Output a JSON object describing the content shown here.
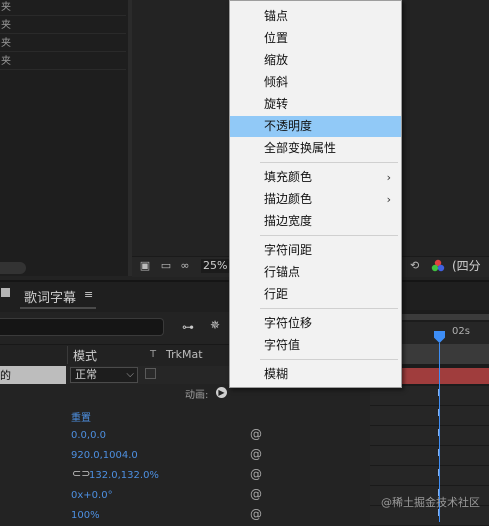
{
  "project_panel": {
    "rows": [
      "夹",
      "夹",
      "夹",
      "夹"
    ]
  },
  "viewer_bar": {
    "zoom": "25%",
    "quality": "(四分"
  },
  "timeline": {
    "tab_label": "歌词字幕",
    "tab_menu_icon": "≡",
    "columns": {
      "mode": "模式",
      "t": "T",
      "trkmat": "TrkMat"
    },
    "layer": {
      "name": "的",
      "mode": "正常"
    },
    "animate_label": "动画:",
    "properties": {
      "reset": "重置",
      "anchor": "0.0,0.0",
      "position": "920.0,1004.0",
      "scale": "132.0,132.0%",
      "rotation": "0x+0.0°",
      "opacity": "100%"
    },
    "ruler_label": "02s",
    "watermark": "@稀土掘金技术社区"
  },
  "context_menu": {
    "items": [
      {
        "label": "锚点",
        "submenu": false
      },
      {
        "label": "位置",
        "submenu": false
      },
      {
        "label": "缩放",
        "submenu": false
      },
      {
        "label": "倾斜",
        "submenu": false
      },
      {
        "label": "旋转",
        "submenu": false
      },
      {
        "label": "不透明度",
        "submenu": false,
        "highlighted": true
      },
      {
        "label": "全部变换属性",
        "submenu": false
      },
      {
        "label": "填充颜色",
        "submenu": true
      },
      {
        "label": "描边颜色",
        "submenu": true
      },
      {
        "label": "描边宽度",
        "submenu": false
      },
      {
        "label": "字符间距",
        "submenu": false
      },
      {
        "label": "行锚点",
        "submenu": false
      },
      {
        "label": "行距",
        "submenu": false
      },
      {
        "label": "字符位移",
        "submenu": false
      },
      {
        "label": "字符值",
        "submenu": false
      },
      {
        "label": "模糊",
        "submenu": false
      }
    ],
    "submenu_arrow": "›"
  },
  "colors": {
    "highlight": "#91c9f7",
    "accent_blue": "#3d8df5",
    "layer_bar": "#a03d3d"
  }
}
